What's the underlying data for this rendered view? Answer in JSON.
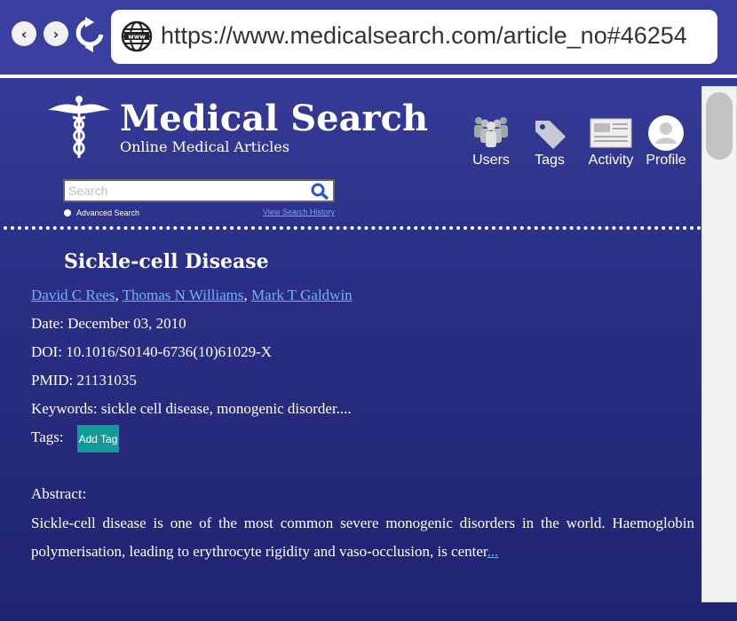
{
  "browser": {
    "url": "https://www.medicalsearch.com/article_no#46254"
  },
  "site": {
    "title": "Medical Search",
    "subtitle": "Online Medical Articles"
  },
  "header_nav": [
    {
      "label": "Users",
      "icon": "users-icon"
    },
    {
      "label": "Tags",
      "icon": "tag-icon"
    },
    {
      "label": "Activity",
      "icon": "activity-icon"
    },
    {
      "label": "Profile",
      "icon": "profile-icon"
    }
  ],
  "search": {
    "placeholder": "Search",
    "advanced_label": "Advanced Search",
    "history_link": "View Search History"
  },
  "article": {
    "title": "Sickle-cell Disease",
    "authors": [
      "David C Rees",
      "Thomas N Williams",
      "Mark T Galdwin"
    ],
    "author_separator": ", ",
    "date": "Date: December 03, 2010",
    "doi": "DOI: 10.1016/S0140-6736(10)61029-X",
    "pmid": "PMID: 21131035",
    "keywords": "Keywords: sickle cell disease, monogenic disorder....",
    "tags_label": "Tags:",
    "add_tag_label": "Add Tag",
    "abstract_label": "Abstract:",
    "abstract_text": "Sickle-cell disease is one of the most common severe monogenic disorders in the world. Haemoglobin polymerisation, leading to erythrocyte rigidity and vaso-occlusion, is center",
    "more_link": "..."
  },
  "colors": {
    "link": "#6fb0ff",
    "add_tag_bg": "#119a9a",
    "background": "#2a2f85"
  }
}
